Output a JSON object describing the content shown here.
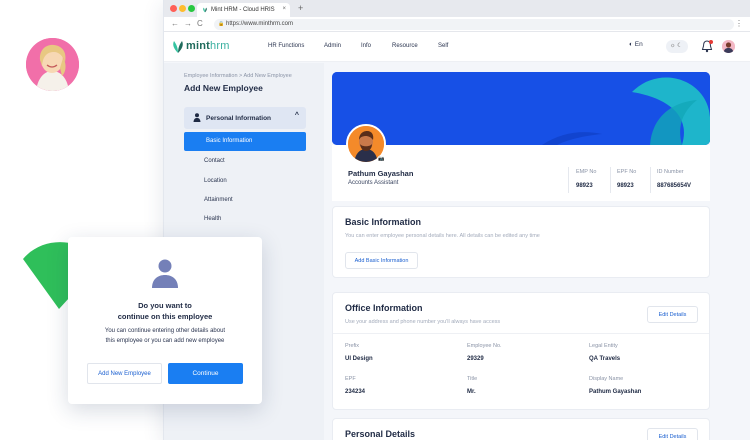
{
  "browser": {
    "tab_title": "Mint HRM - Cloud HRIS",
    "tab_close": "×",
    "new_tab": "+",
    "url": "https://www.minthrm.com",
    "nav_back": "←",
    "nav_forward": "→",
    "nav_reload": "C",
    "menu": "⋮"
  },
  "header": {
    "brand_main": "mint",
    "brand_accent": "hrm",
    "nav": [
      "HR Functions",
      "Admin",
      "Info",
      "Resource",
      "Self"
    ],
    "language": "En",
    "theme_icons": "☼ ☾"
  },
  "sidebar": {
    "breadcrumb": "Employee Information > Add New Employee",
    "title": "Add New Employee",
    "section": "Personal Information",
    "chevron": "^",
    "active_item": "Basic Information",
    "items": [
      "Contact",
      "Location",
      "Attainment",
      "Health"
    ]
  },
  "profile": {
    "name": "Pathum Gayashan",
    "role": "Accounts Assistant",
    "stats": [
      {
        "label": "EMP No",
        "value": "98923"
      },
      {
        "label": "EPF No",
        "value": "98923"
      },
      {
        "label": "ID Number",
        "value": "887685654V"
      }
    ]
  },
  "basic_info": {
    "title": "Basic Information",
    "subtitle": "You can enter employee personal details here. All details can be edited any time",
    "button": "Add Basic Information"
  },
  "office_info": {
    "title": "Office Information",
    "subtitle": "Use your address and phone number you'll always have access",
    "button": "Edit Details",
    "fields": [
      {
        "label": "Prefix",
        "value": "UI Design"
      },
      {
        "label": "Employee No.",
        "value": "29329"
      },
      {
        "label": "Legal Entity",
        "value": "QA Travels"
      },
      {
        "label": "EPF",
        "value": "234234"
      },
      {
        "label": "Title",
        "value": "Mr."
      },
      {
        "label": "Display Name",
        "value": "Pathum Gayashan"
      }
    ]
  },
  "personal_details": {
    "title": "Personal Details",
    "button": "Edit Details"
  },
  "dialog": {
    "title_line1": "Do you want to",
    "title_line2": "continue on this employee",
    "body_line1": "You can continue entering other details about",
    "body_line2": "this employee or you can add new employee",
    "secondary_button": "Add New Employee",
    "primary_button": "Continue"
  },
  "colors": {
    "primary": "#1a7ef2",
    "cover": "#1750e6",
    "brand": "#1f6b5c",
    "accent_green": "#2fbf5a"
  }
}
